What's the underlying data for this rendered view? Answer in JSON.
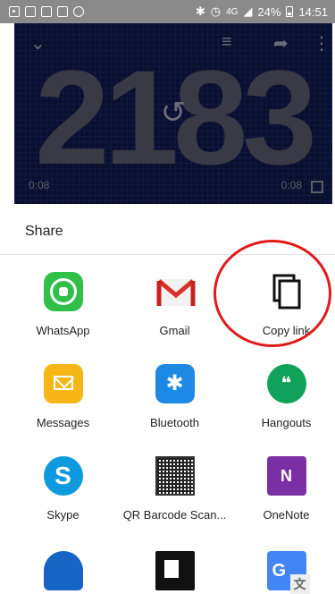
{
  "status_bar": {
    "percent": "24%",
    "time": "14:51",
    "net_label": "4G"
  },
  "video": {
    "overlay_number": "2183",
    "time_left": "0:08",
    "time_right": "0:08",
    "icons": [
      "chevron-down-icon",
      "add-to-queue-icon",
      "share-icon",
      "more-vert-icon",
      "replay-icon",
      "fullscreen-icon"
    ]
  },
  "share_sheet": {
    "title": "Share",
    "apps": [
      {
        "label": "WhatsApp",
        "icon": "whatsapp-icon"
      },
      {
        "label": "Gmail",
        "icon": "gmail-icon"
      },
      {
        "label": "Copy link",
        "icon": "copy-link-icon"
      },
      {
        "label": "Messages",
        "icon": "messages-icon"
      },
      {
        "label": "Bluetooth",
        "icon": "bluetooth-icon"
      },
      {
        "label": "Hangouts",
        "icon": "hangouts-icon"
      },
      {
        "label": "Skype",
        "icon": "skype-icon"
      },
      {
        "label": "QR Barcode Scan...",
        "icon": "qr-icon"
      },
      {
        "label": "OneNote",
        "icon": "onenote-icon"
      },
      {
        "label": "",
        "icon": "onedrive-icon"
      },
      {
        "label": "",
        "icon": "app-icon"
      },
      {
        "label": "",
        "icon": "google-translate-icon"
      }
    ]
  },
  "colors": {
    "annotation_circle": "#e01b1b",
    "status_bar": "#8a8a8a",
    "video_bg": "#0b0f2e"
  }
}
